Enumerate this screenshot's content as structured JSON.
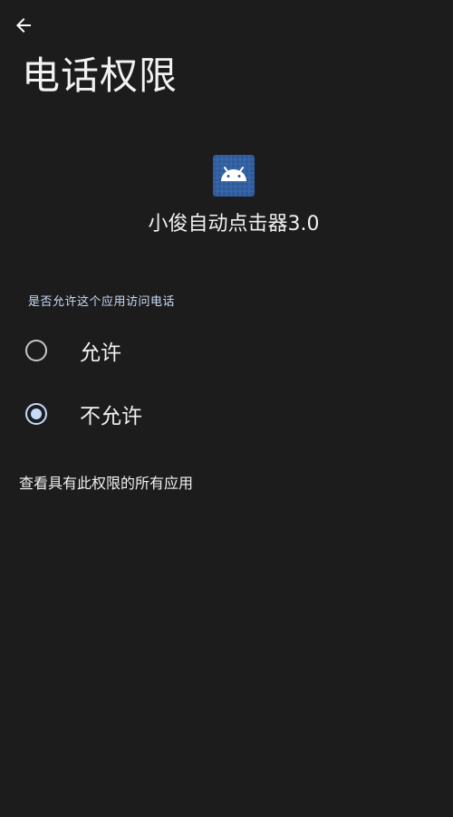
{
  "header": {
    "back_icon": "arrow-left-icon",
    "title": "电话权限"
  },
  "app": {
    "icon": "android-app-icon",
    "icon_color": "#2e5a9a",
    "name": "小俊自动点击器3.0"
  },
  "permission": {
    "question": "是否允许这个应用访问电话",
    "options": [
      {
        "label": "允许",
        "selected": false
      },
      {
        "label": "不允许",
        "selected": true
      }
    ]
  },
  "footer": {
    "see_all_label": "查看具有此权限的所有应用"
  },
  "colors": {
    "background": "#1c1c1c",
    "accent": "#c6dcfb",
    "text": "#f0f0f0"
  }
}
